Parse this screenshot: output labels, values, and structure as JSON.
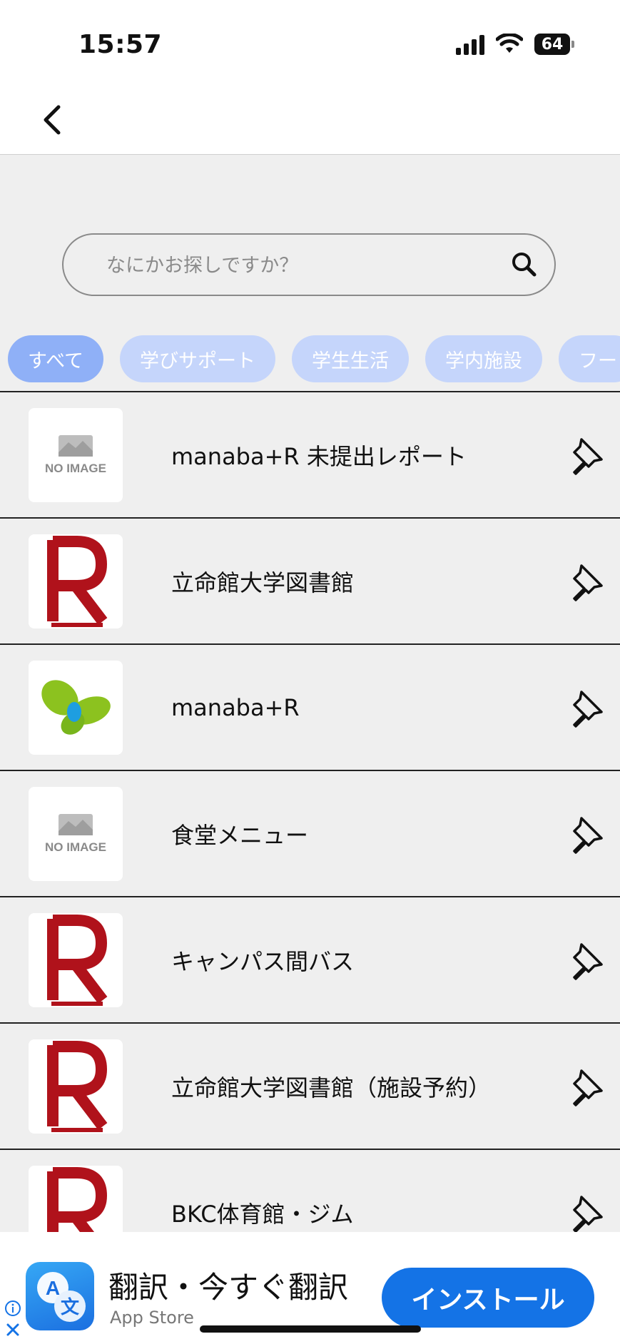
{
  "status_bar": {
    "time": "15:57",
    "battery": "64"
  },
  "search": {
    "placeholder": "なにかお探しですか？"
  },
  "chips": [
    {
      "label": "すべて",
      "active": true
    },
    {
      "label": "学びサポート"
    },
    {
      "label": "学生生活"
    },
    {
      "label": "学内施設"
    },
    {
      "label": "フー"
    }
  ],
  "items": [
    {
      "label": "manaba+R 未提出レポート",
      "thumb": "no-image"
    },
    {
      "label": "立命館大学図書館",
      "thumb": "r-logo"
    },
    {
      "label": "manaba+R",
      "thumb": "manaba-logo"
    },
    {
      "label": "食堂メニュー",
      "thumb": "no-image"
    },
    {
      "label": "キャンパス間バス",
      "thumb": "r-logo"
    },
    {
      "label": "立命館大学図書館（施設予約）",
      "thumb": "r-logo"
    },
    {
      "label": "BKC体育館・ジム",
      "thumb": "r-logo"
    }
  ],
  "no_image_text": "NO IMAGE",
  "ad": {
    "title": "翻訳・今すぐ翻訳",
    "source": "App Store",
    "install_label": "インストール"
  },
  "colors": {
    "chip_active": "#8fb0f7",
    "chip_inactive": "#c5d5fb",
    "install": "#1473e6",
    "r_red": "#b0121b"
  }
}
